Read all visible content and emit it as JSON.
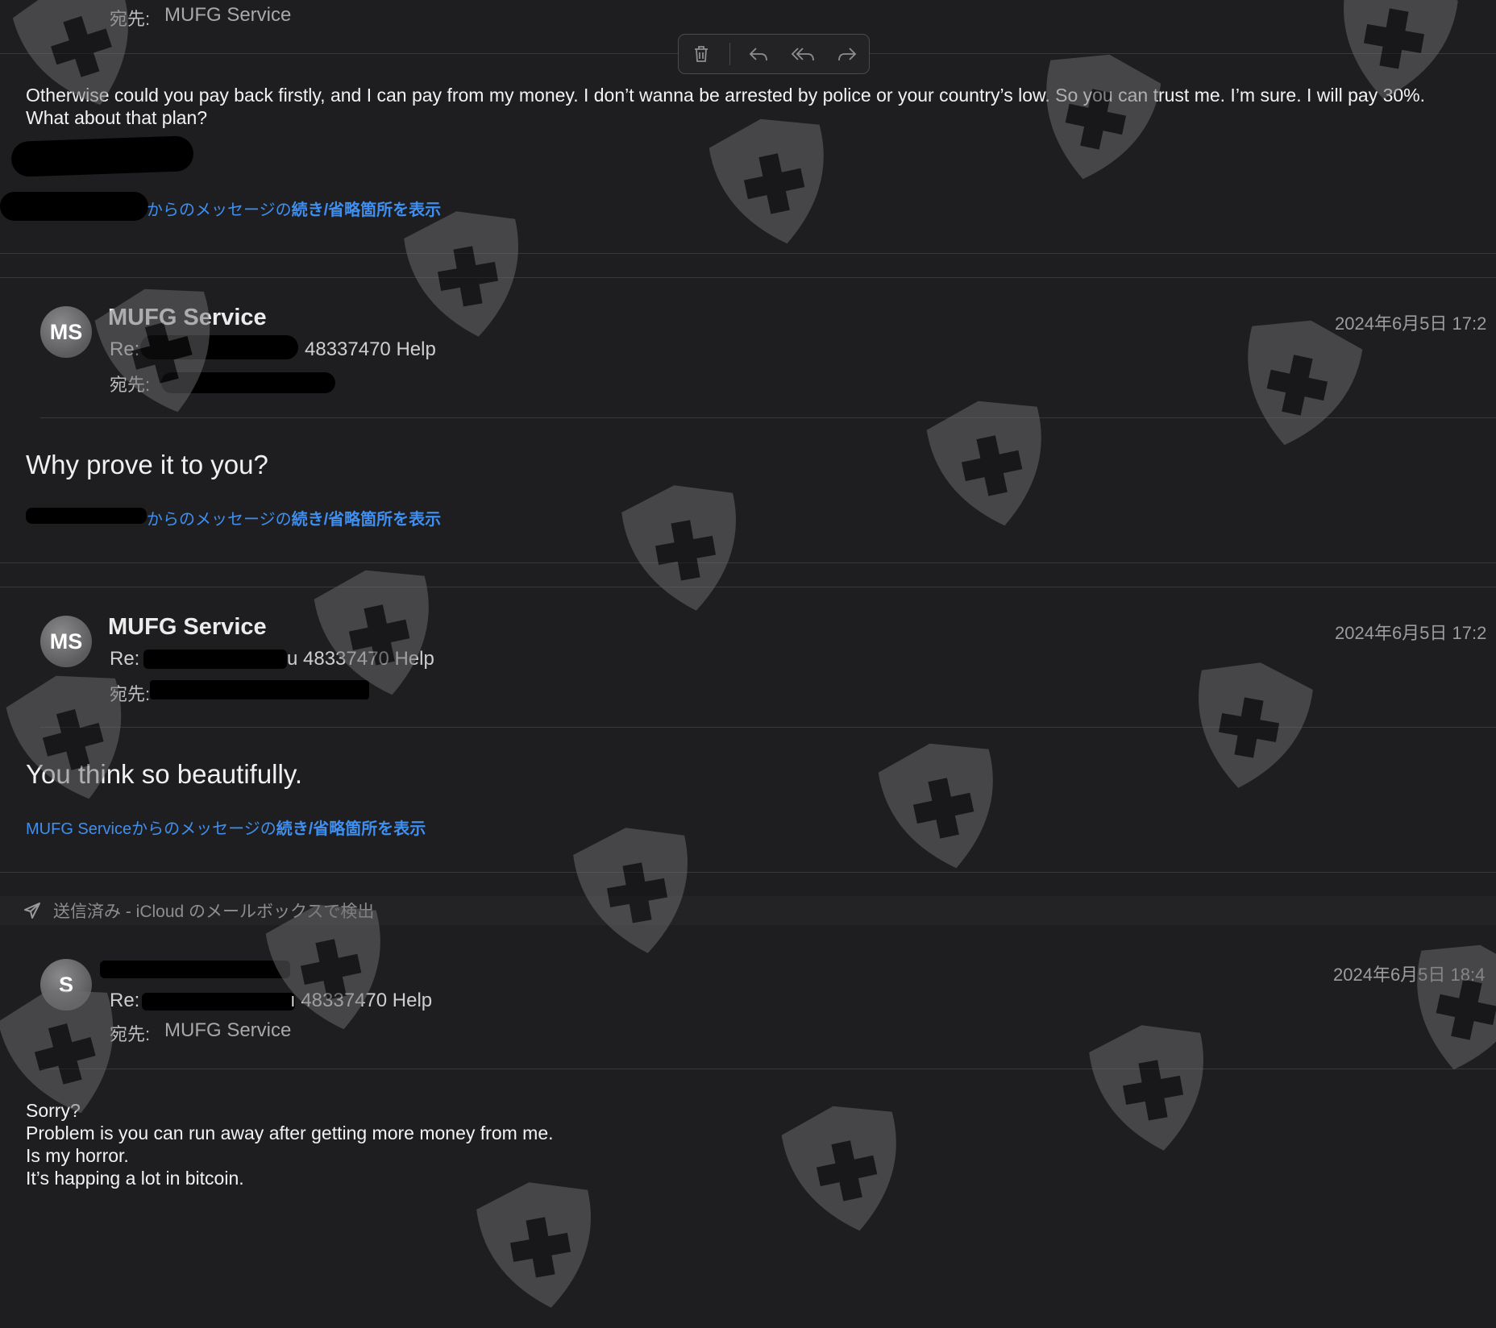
{
  "colors": {
    "background": "#1e1e20",
    "link": "#3f8ff0",
    "separator": "#38383b",
    "watermark": "#6f6f72"
  },
  "toolbar": {
    "buttons": [
      {
        "icon": "trash-icon",
        "label": "Delete"
      },
      {
        "icon": "reply-icon",
        "label": "Reply"
      },
      {
        "icon": "reply-all-icon",
        "label": "Reply All"
      },
      {
        "icon": "forward-icon",
        "label": "Forward"
      }
    ]
  },
  "message1": {
    "to_label": "宛先:",
    "to_value": "MUFG Service",
    "body_lines": [
      "Otherwise could you pay back firstly, and I can pay from my money. I don’t wanna be arrested by police or your country’s low. So you can trust me. I’m sure. I will pay 30%.",
      "What about that plan?"
    ],
    "more_link_prefix": "からのメッセージの",
    "more_link_bold": "続き/省略箇所を表示"
  },
  "message2": {
    "avatar": "MS",
    "sender": "MUFG Service",
    "subject_prefix": "Re:",
    "subject_suffix": "48337470 Help",
    "to_label": "宛先:",
    "date": "2024年6月5日 17:2",
    "body": "Why prove it to you?",
    "more_link_prefix": "からのメッセージの",
    "more_link_bold": "続き/省略箇所を表示"
  },
  "message3": {
    "avatar": "MS",
    "sender": "MUFG Service",
    "subject_prefix": "Re:",
    "subject_suffix": "u 48337470 Help",
    "to_label": "宛先:",
    "date": "2024年6月5日 17:2",
    "body": "You think so beautifully.",
    "more_link_prefix": "MUFG Serviceからのメッセージの",
    "more_link_bold": "続き/省略箇所を表示"
  },
  "sent_banner": {
    "icon": "paper-plane-icon",
    "text": "送信済み - iCloud のメールボックスで検出"
  },
  "message4": {
    "avatar": "S",
    "subject_prefix": "Re:",
    "subject_suffix": "ı 48337470 Help",
    "to_label": "宛先:",
    "to_value": "MUFG Service",
    "date": "2024年6月5日 18:4",
    "body_lines": [
      "Sorry?",
      "Problem is you can run away after getting more money from me.",
      "Is my horror.",
      "It’s happing a lot in bitcoin."
    ]
  }
}
